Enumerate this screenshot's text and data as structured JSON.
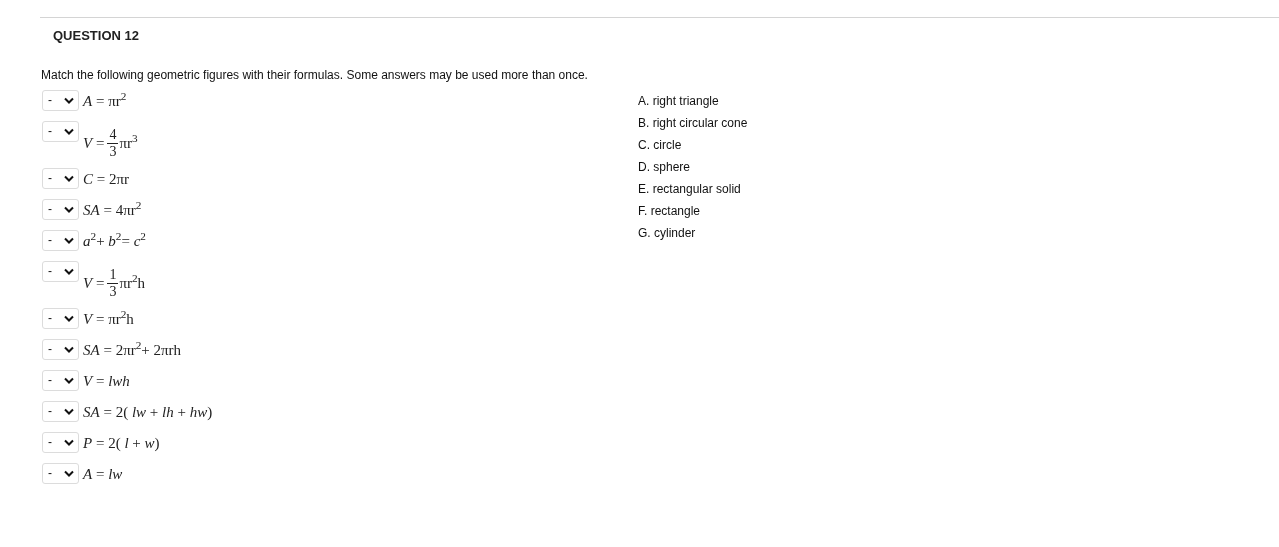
{
  "question": {
    "title": "QUESTION 12",
    "instructions": "Match the following geometric figures with their formulas. Some answers may be used more than once."
  },
  "items": [
    {
      "kind": "inline",
      "select_value": "-",
      "formula": "*A* = πr$^{2}$"
    },
    {
      "kind": "fraction",
      "select_value": "-",
      "lhs": "*V* =",
      "numerator": "4",
      "denominator": "3",
      "rhs": "πr$^{3}$"
    },
    {
      "kind": "inline",
      "select_value": "-",
      "formula": "*C* = 2πr"
    },
    {
      "kind": "inline",
      "select_value": "-",
      "formula": "*SA* = 4πr$^{2}$"
    },
    {
      "kind": "inline",
      "select_value": "-",
      "formula": "*a*$^{2}$+ *b*$^{2}$= *c*$^{2}$"
    },
    {
      "kind": "fraction",
      "select_value": "-",
      "lhs": "*V* =",
      "numerator": "1",
      "denominator": "3",
      "rhs": "πr$^{2}$h"
    },
    {
      "kind": "inline",
      "select_value": "-",
      "formula": "*V* = πr$^{2}$h"
    },
    {
      "kind": "inline",
      "select_value": "-",
      "formula": "*SA* = 2πr$^{2}$+ 2πrh"
    },
    {
      "kind": "inline",
      "select_value": "-",
      "formula": "*V* = *lwh*"
    },
    {
      "kind": "inline",
      "select_value": "-",
      "formula": "*SA* = 2( *lw* + *lh* + *hw*)"
    },
    {
      "kind": "inline",
      "select_value": "-",
      "formula": "*P* = 2( *l* + *w*)"
    },
    {
      "kind": "inline",
      "select_value": "-",
      "formula": "*A* = *lw*"
    }
  ],
  "answers": [
    {
      "letter": "A.",
      "text": "right triangle"
    },
    {
      "letter": "B.",
      "text": "right circular cone"
    },
    {
      "letter": "C.",
      "text": "circle"
    },
    {
      "letter": "D.",
      "text": "sphere"
    },
    {
      "letter": "E.",
      "text": "rectangular solid"
    },
    {
      "letter": "F.",
      "text": "rectangle"
    },
    {
      "letter": "G.",
      "text": "cylinder"
    }
  ]
}
